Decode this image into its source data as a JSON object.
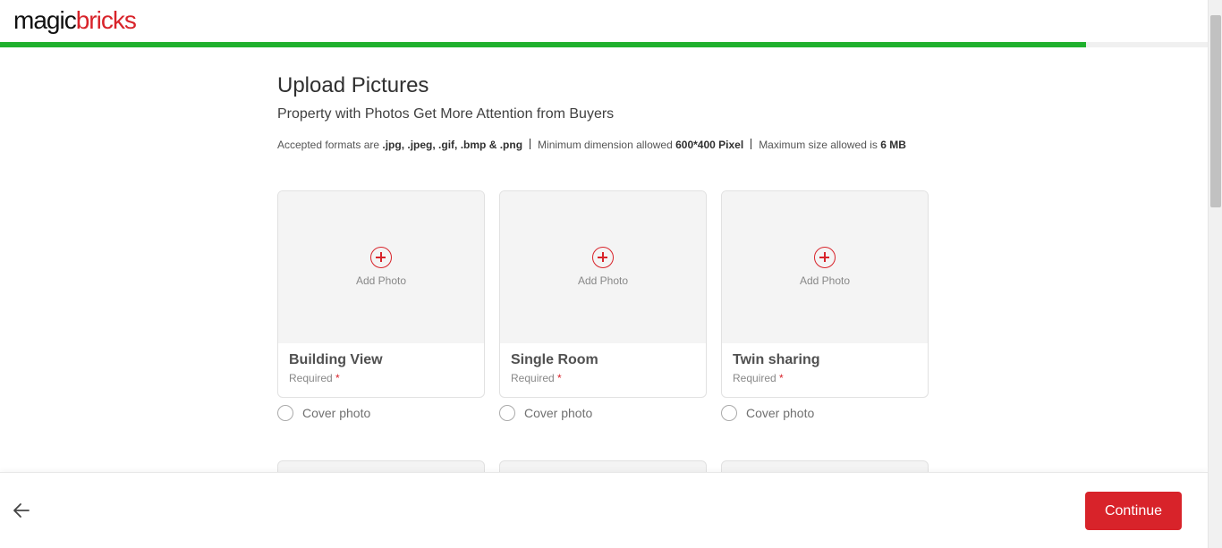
{
  "header": {
    "logo_part1": "magic",
    "logo_part2": "bricks",
    "progress_fraction": 0.899
  },
  "main": {
    "title": "Upload Pictures",
    "subtitle": "Property with Photos Get More Attention from Buyers",
    "formats": {
      "accepted_prefix": "Accepted formats are ",
      "accepted_value": ".jpg, .jpeg, .gif, .bmp & .png",
      "min_prefix": "Minimum dimension allowed ",
      "min_value": "600*400 Pixel",
      "max_prefix": "Maximum size allowed is ",
      "max_value": "6 MB"
    },
    "cards": [
      {
        "add_label": "Add Photo",
        "name": "Building View",
        "required": "Required",
        "star": "*",
        "cover_label": "Cover photo"
      },
      {
        "add_label": "Add Photo",
        "name": "Single Room",
        "required": "Required",
        "star": "*",
        "cover_label": "Cover photo"
      },
      {
        "add_label": "Add Photo",
        "name": "Twin sharing",
        "required": "Required",
        "star": "*",
        "cover_label": "Cover photo"
      }
    ]
  },
  "footer": {
    "continue_label": "Continue",
    "back_icon": "arrow-left-icon"
  },
  "colors": {
    "brand_red": "#d8232a",
    "progress_green": "#1fb02d"
  }
}
